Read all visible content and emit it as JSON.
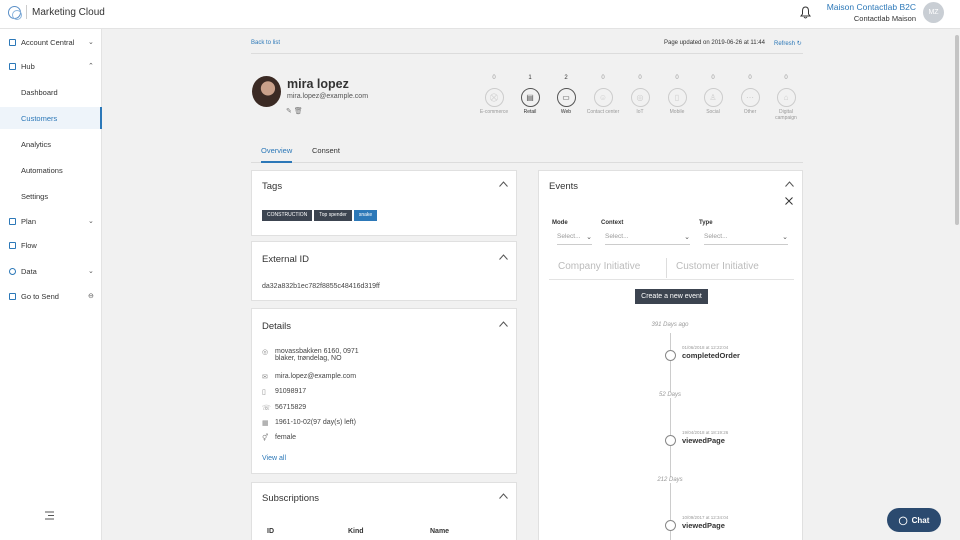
{
  "app": {
    "title": "Marketing Cloud"
  },
  "header": {
    "org_name": "Maison Contactlab B2C",
    "org_sub": "Contactlab Maison",
    "avatar_initials": "MZ"
  },
  "sidebar": {
    "items": [
      {
        "label": "Account Central",
        "icon": "gear-icon",
        "chevron": "down"
      },
      {
        "label": "Hub",
        "icon": "hub-icon",
        "chevron": "up"
      },
      {
        "label": "Dashboard"
      },
      {
        "label": "Customers",
        "active": true
      },
      {
        "label": "Analytics"
      },
      {
        "label": "Automations"
      },
      {
        "label": "Settings"
      },
      {
        "label": "Plan",
        "icon": "plan-icon",
        "chevron": "down"
      },
      {
        "label": "Flow",
        "icon": "flow-icon"
      },
      {
        "label": "Data",
        "icon": "data-icon",
        "chevron": "down"
      },
      {
        "label": "Go to Send",
        "icon": "send-icon",
        "trailing": "link-icon"
      }
    ]
  },
  "toolbar": {
    "back_label": "Back to list",
    "updated_text": "Page updated on 2019-06-26 at 11:44",
    "refresh_label": "Refresh"
  },
  "profile": {
    "name": "mira lopez",
    "email": "mira.lopez@example.com"
  },
  "channels": [
    {
      "count": "0",
      "label": "E-commerce",
      "icon": "cart-icon"
    },
    {
      "count": "1",
      "label": "Retail",
      "icon": "store-icon",
      "active": true
    },
    {
      "count": "2",
      "label": "Web",
      "icon": "monitor-icon",
      "active": true
    },
    {
      "count": "0",
      "label": "Contact center",
      "icon": "agent-icon"
    },
    {
      "count": "0",
      "label": "IoT",
      "icon": "iot-icon"
    },
    {
      "count": "0",
      "label": "Mobile",
      "icon": "mobile-icon"
    },
    {
      "count": "0",
      "label": "Social",
      "icon": "social-icon"
    },
    {
      "count": "0",
      "label": "Other",
      "icon": "more-icon"
    },
    {
      "count": "0",
      "label": "Digital campaign",
      "icon": "campaign-icon"
    }
  ],
  "tabs": [
    {
      "label": "Overview",
      "active": true
    },
    {
      "label": "Consent"
    }
  ],
  "tags_card": {
    "title": "Tags",
    "tags": [
      {
        "label": "CONSTRUCTION",
        "style": "dark"
      },
      {
        "label": "Top spender",
        "style": "dark"
      },
      {
        "label": "snake",
        "style": "blue"
      }
    ]
  },
  "external_card": {
    "title": "External ID",
    "value": "da32a832b1ec782f8855c48416d319ff"
  },
  "details_card": {
    "title": "Details",
    "address_line1": "movassbakken 6160, 0971",
    "address_line2": "blaker, trøndelag, NO",
    "email": "mira.lopez@example.com",
    "mobile": "91098917",
    "phone": "56715829",
    "birthday": "1961-10-02(97 day(s) left)",
    "gender": "female",
    "view_all": "View all"
  },
  "subscriptions_card": {
    "title": "Subscriptions",
    "columns": [
      "ID",
      "Kind",
      "Name"
    ]
  },
  "events_card": {
    "title": "Events",
    "filters": [
      {
        "label": "Mode",
        "placeholder": "Select..."
      },
      {
        "label": "Context",
        "placeholder": "Select..."
      },
      {
        "label": "Type",
        "placeholder": "Select..."
      }
    ],
    "initiatives": [
      "Company Initiative",
      "Customer Initiative"
    ],
    "create_label": "Create a new event",
    "gaps": [
      "391 Days ago",
      "52 Days",
      "212 Days"
    ],
    "events": [
      {
        "date": "01/06/2018 at 12:22:04",
        "name": "completedOrder"
      },
      {
        "date": "19/04/2018 at 18:19:26",
        "name": "viewedPage"
      },
      {
        "date": "10/09/2017 at 12:34:04",
        "name": "viewedPage"
      }
    ]
  },
  "chat": {
    "label": "Chat"
  },
  "colors": {
    "accent": "#2c78b8",
    "dark": "#3c4450",
    "chat": "#2b4a6f"
  }
}
